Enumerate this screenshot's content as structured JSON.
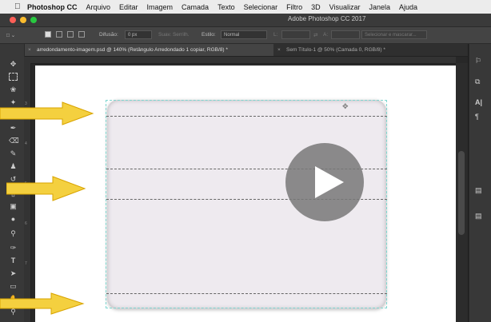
{
  "menubar": {
    "items": [
      "Photoshop CC",
      "Arquivo",
      "Editar",
      "Imagem",
      "Camada",
      "Texto",
      "Selecionar",
      "Filtro",
      "3D",
      "Visualizar",
      "Janela",
      "Ajuda"
    ]
  },
  "window": {
    "title": "Adobe Photoshop CC 2017"
  },
  "options_bar": {
    "difusao_label": "Difusão:",
    "difusao_value": "0 px",
    "suav_label": "Suav. Serrilh.",
    "estilo_label": "Estilo:",
    "estilo_value": "Normal",
    "largura_label": "L:",
    "altura_label": "A:",
    "select_mask_label": "Selecionar e mascarar..."
  },
  "tabs": [
    {
      "label": "arredondamento-imagem.psd @ 140% (Retângulo Arredondado 1 copiar, RGB/8) *",
      "active": true
    },
    {
      "label": "Sem Título-1 @ 50% (Camada 0, RGB/8) *",
      "active": false
    }
  ],
  "ruler": {
    "left_numbers": [
      "3",
      "4",
      "5",
      "6",
      "7"
    ]
  },
  "tools": [
    "move-icon",
    "marquee-icon",
    "lasso-icon",
    "magic-wand-icon",
    "crop-icon",
    "eyedropper-icon",
    "healing-icon",
    "brush-icon",
    "stamp-icon",
    "history-brush-icon",
    "eraser-icon",
    "gradient-icon",
    "blur-icon",
    "dodge-icon",
    "pen-icon",
    "type-icon",
    "path-selection-icon",
    "rectangle-icon",
    "hand-icon",
    "zoom-icon"
  ],
  "right_panel": [
    "history-icon",
    "layers-icon",
    "character-icon",
    "paragraph-icon"
  ],
  "colors": {
    "arrow": "#f4d03f",
    "selection": "#7fd6d0",
    "shape_fill": "#eeeaef"
  }
}
